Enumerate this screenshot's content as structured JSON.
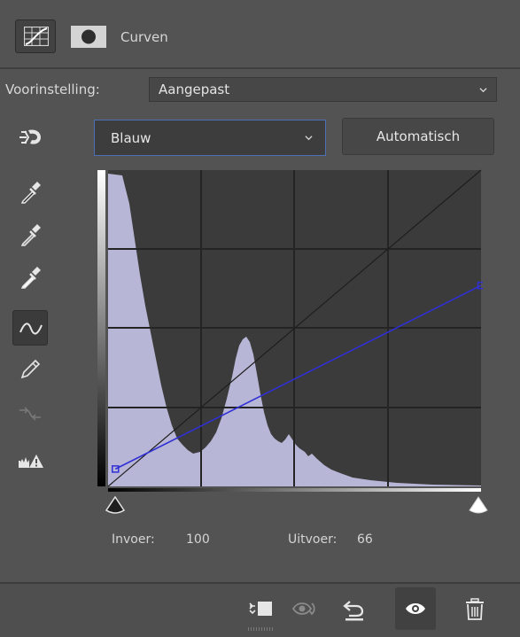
{
  "panel": {
    "title": "Curven",
    "header_icons": [
      "curves-adjustment-icon",
      "layer-mask-icon"
    ]
  },
  "preset": {
    "label": "Voorinstelling:",
    "value": "Aangepast"
  },
  "channel": {
    "value": "Blauw"
  },
  "auto_button": {
    "label": "Automatisch"
  },
  "tools": [
    "on-image-adjust-icon",
    "black-point-eyedropper-icon",
    "gray-point-eyedropper-icon",
    "white-point-eyedropper-icon",
    "curve-points-icon",
    "pencil-draw-icon",
    "smooth-curve-icon",
    "clipping-warning-icon"
  ],
  "graph": {
    "curve_color": "#2f2fd6",
    "histogram_color": "#b8b6d6",
    "background": "#3b3b3b",
    "grid_color": "#262626",
    "curve_points": [
      {
        "input": 5,
        "output": 14
      },
      {
        "input": 255,
        "output": 162
      }
    ]
  },
  "readout": {
    "input_label": "Invoer:",
    "input_value": "100",
    "output_label": "Uitvoer:",
    "output_value": "66"
  },
  "footer": {
    "buttons": [
      "clip-to-layer-icon",
      "view-previous-state-icon",
      "reset-icon",
      "visibility-icon",
      "delete-icon"
    ]
  }
}
